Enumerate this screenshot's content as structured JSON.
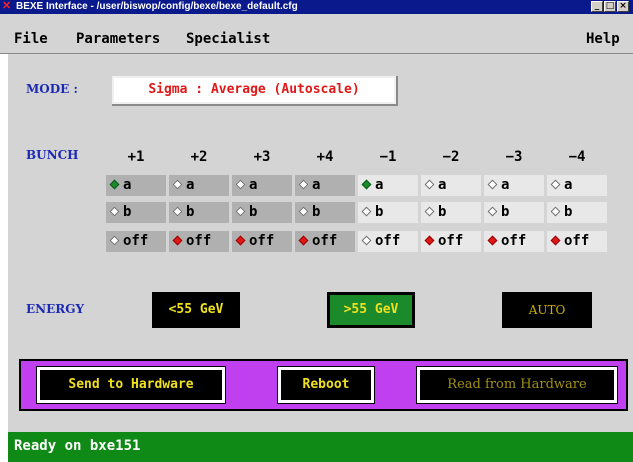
{
  "window": {
    "title": "BEXE Interface - /user/biswop/config/bexe/bexe_default.cfg",
    "buttons": [
      "_",
      "□",
      "×"
    ]
  },
  "menu": {
    "file": "File",
    "parameters": "Parameters",
    "specialist": "Specialist",
    "help": "Help"
  },
  "mode": {
    "label": "MODE :",
    "value": "Sigma : Average (Autoscale)"
  },
  "bunch": {
    "label": "BUNCH",
    "columns": [
      {
        "header": "+1",
        "selected": "a"
      },
      {
        "header": "+2",
        "selected": "off"
      },
      {
        "header": "+3",
        "selected": "off"
      },
      {
        "header": "+4",
        "selected": "off"
      },
      {
        "header": "−1",
        "selected": "a"
      },
      {
        "header": "−2",
        "selected": "off"
      },
      {
        "header": "−3",
        "selected": "off"
      },
      {
        "header": "−4",
        "selected": "off"
      }
    ],
    "options": [
      "a",
      "b",
      "off"
    ]
  },
  "energy": {
    "label": "ENERGY",
    "low": {
      "label": "<55 GeV",
      "color": "#000000",
      "text_color": "#f0e020"
    },
    "high": {
      "label": ">55 GeV",
      "color": "#1a8a2a",
      "text_color": "#f0e020"
    },
    "auto": {
      "label": "AUTO",
      "color": "#000000",
      "text_color": "#c8b000"
    }
  },
  "actions": {
    "send": "Send to Hardware",
    "reboot": "Reboot",
    "read": "Read from Hardware"
  },
  "status": {
    "text": "Ready on bxe151"
  },
  "colors": {
    "panel": "#d4d4d4",
    "action_panel": "#c040f0",
    "status_bar": "#0f8a16",
    "title_bar": "#0a1a8c"
  }
}
